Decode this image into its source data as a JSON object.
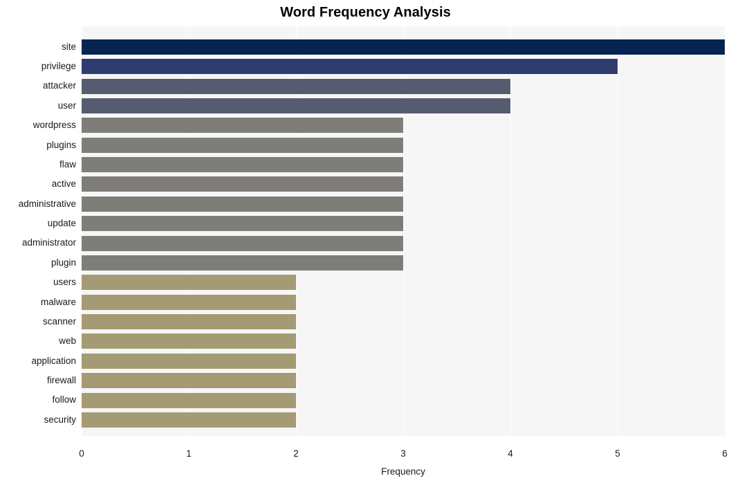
{
  "chart_data": {
    "type": "bar",
    "orientation": "horizontal",
    "title": "Word Frequency Analysis",
    "xlabel": "Frequency",
    "ylabel": "",
    "xlim": [
      0,
      6
    ],
    "xticks": [
      "0",
      "1",
      "2",
      "3",
      "4",
      "5",
      "6"
    ],
    "grid": true,
    "legend": "none",
    "plot_background": "#f6f6f6",
    "gridline_color": "#ffffff",
    "categories": [
      "site",
      "privilege",
      "attacker",
      "user",
      "wordpress",
      "plugins",
      "flaw",
      "active",
      "administrative",
      "update",
      "administrator",
      "plugin",
      "users",
      "malware",
      "scanner",
      "web",
      "application",
      "firewall",
      "follow",
      "security"
    ],
    "values": [
      6,
      5,
      4,
      4,
      3,
      3,
      3,
      3,
      3,
      3,
      3,
      3,
      2,
      2,
      2,
      2,
      2,
      2,
      2,
      2
    ],
    "bar_colors": [
      "#062450",
      "#2d3e6e",
      "#565c70",
      "#565c70",
      "#7e7d78",
      "#7e7d78",
      "#7e7d78",
      "#7e7d78",
      "#7e7d78",
      "#7e7d78",
      "#7e7d78",
      "#7e7d78",
      "#a49b74",
      "#a49b74",
      "#a49b74",
      "#a49b74",
      "#a49b74",
      "#a49b74",
      "#a49b74",
      "#a49b74"
    ]
  }
}
